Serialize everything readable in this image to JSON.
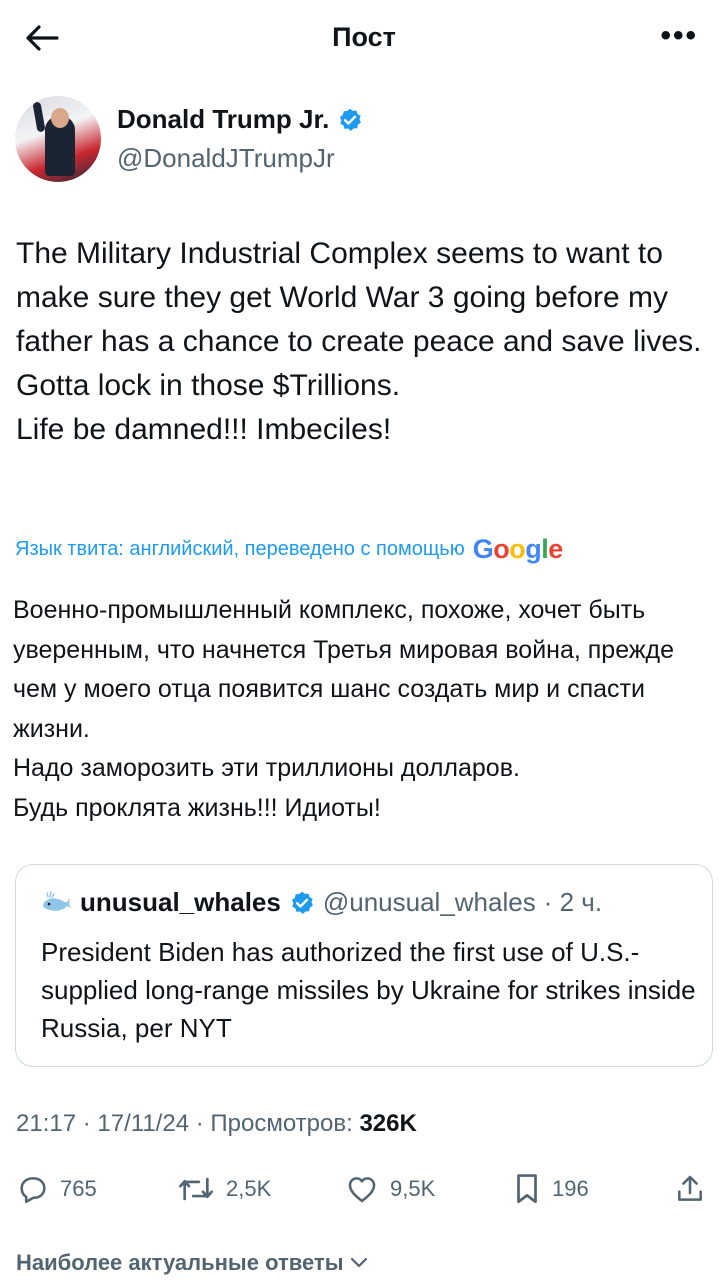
{
  "header": {
    "title": "Пост"
  },
  "author": {
    "display_name": "Donald Trump Jr.",
    "handle": "@DonaldJTrumpJr",
    "verified": true
  },
  "tweet": {
    "text": "The Military Industrial Complex seems to want to make sure they get World War 3 going before my father has a chance to create peace and save lives.\nGotta lock in those $Trillions.\nLife be damned!!! Imbeciles!"
  },
  "translation_note": {
    "label": "Язык твита: английский, переведено с помощью",
    "provider": "Google"
  },
  "translation": {
    "text": "Военно-промышленный комплекс, похоже, хочет быть уверенным, что начнется Третья мировая война, прежде чем у моего отца появится шанс создать мир и спасти жизни.\nНадо заморозить эти триллионы долларов.\nБудь проклята жизнь!!! Идиоты!"
  },
  "quote": {
    "name": "unusual_whales",
    "handle": "@unusual_whales",
    "time": "· 2 ч.",
    "text": "President Biden has authorized the first use of U.S.-supplied long-range missiles by Ukraine for strikes inside Russia, per NYT"
  },
  "meta": {
    "time": "21:17",
    "date": "17/11/24",
    "views_label": "Просмотров:",
    "views": "326K"
  },
  "actions": {
    "replies": "765",
    "reposts": "2,5K",
    "likes": "9,5K",
    "bookmarks": "196"
  },
  "replies_sort": {
    "label": "Наиболее актуальные ответы"
  },
  "colors": {
    "accent": "#1d9bf0",
    "text": "#0f1419",
    "secondary": "#536471",
    "border": "#cfd9de"
  },
  "icons": [
    "back-arrow-icon",
    "more-icon",
    "verified-badge-icon",
    "whale-icon",
    "reply-icon",
    "repost-icon",
    "like-icon",
    "bookmark-icon",
    "share-icon",
    "chevron-down-icon"
  ]
}
